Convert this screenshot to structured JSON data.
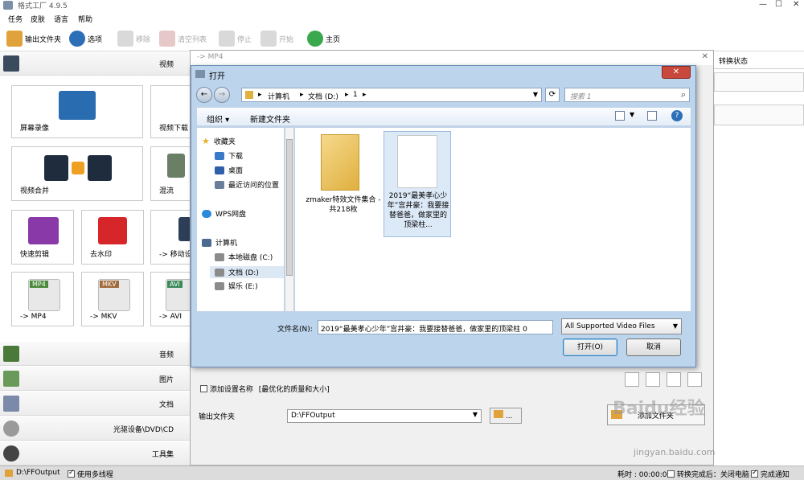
{
  "app": {
    "title": "格式工厂 4.9.5"
  },
  "menu": [
    "任务",
    "皮肤",
    "语言",
    "帮助"
  ],
  "toolbar": {
    "output_folder": "输出文件夹",
    "options": "选项",
    "remove": "移除",
    "clear_list": "清空列表",
    "stop": "停止",
    "start": "开始",
    "home": "主页"
  },
  "categories": {
    "video": "视频",
    "audio": "音频",
    "image": "图片",
    "document": "文档",
    "disc": "光驱设备\\DVD\\CD",
    "tools": "工具集"
  },
  "video_tiles": {
    "screen_record": "屏幕录像",
    "video_download": "视频下载",
    "video_merge": "视频合并",
    "mix": "混流",
    "quick_clip": "快速剪辑",
    "remove_watermark": "去水印",
    "to_mobile": "-> 移动设",
    "to_mp4": "-> MP4",
    "to_mkv": "-> MKV",
    "to_avi": "-> AVI",
    "badge_mp4": "MP4",
    "badge_mkv": "MKV",
    "badge_avi": "AVI"
  },
  "format_window": {
    "title": "-> MP4",
    "add_setting_name": "添加设置名称",
    "preset": "[最优化的质量和大小]",
    "output_folder_label": "输出文件夹",
    "output_path": "D:\\FFOutput",
    "add_file_button": "添加文件夹",
    "browse_button": "..."
  },
  "right_column": {
    "header": "转换状态"
  },
  "open_dialog": {
    "title": "打开",
    "breadcrumb": [
      "计算机",
      "文档 (D:)",
      "1"
    ],
    "search_placeholder": "搜索 1",
    "organize": "组织",
    "new_folder": "新建文件夹",
    "nav_items": [
      {
        "label": "收藏夹",
        "color": "#e6b422"
      },
      {
        "label": "下载",
        "color": "#3a78c8"
      },
      {
        "label": "桌面",
        "color": "#2e5fa8"
      },
      {
        "label": "最近访问的位置",
        "color": "#6a7f9a"
      },
      {
        "label": "WPS网盘",
        "color": "#2a8ad8"
      },
      {
        "label": "计算机",
        "color": "#4a6a90"
      },
      {
        "label": "本地磁盘 (C:)",
        "color": "#8b8b8b"
      },
      {
        "label": "文档 (D:)",
        "color": "#8b8b8b"
      },
      {
        "label": "娱乐 (E:)",
        "color": "#8b8b8b"
      }
    ],
    "files": [
      {
        "name": "zmaker特效文件集合 - 共218枚",
        "type": "folder"
      },
      {
        "name": "2019“最美孝心少年”宫井豪：我要接替爸爸，做家里的顶梁柱...",
        "type": "file"
      }
    ],
    "filename_label": "文件名(N):",
    "filename_value": "2019“最美孝心少年”宫井豪：我要接替爸爸，做家里的顶梁柱 0",
    "filetype_value": "All Supported Video Files",
    "open_button": "打开(O)",
    "cancel_button": "取消"
  },
  "statusbar": {
    "output_path": "D:\\FFOutput",
    "multithread": "使用多线程",
    "elapsed": "耗时 : 00:00:00",
    "after_done": "转换完成后：关闭电脑",
    "notify": "完成通知"
  },
  "watermark": {
    "brand": "Baidu经验",
    "url": "jingyan.baidu.com"
  }
}
